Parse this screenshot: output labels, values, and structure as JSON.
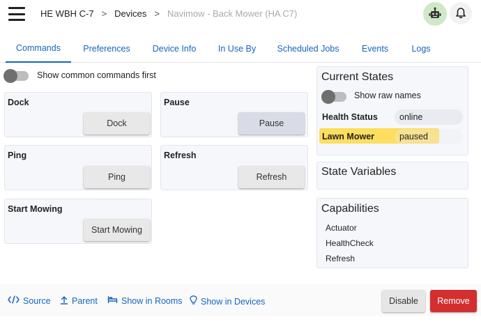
{
  "header": {
    "breadcrumbs": [
      "HE WBH C-7",
      "Devices",
      "Navimow - Back Mower (HA C7)"
    ],
    "separator": ">",
    "icons": [
      "menu-icon",
      "robot-icon",
      "bell-icon"
    ]
  },
  "tabs": [
    {
      "label": "Commands",
      "active": true
    },
    {
      "label": "Preferences",
      "active": false
    },
    {
      "label": "Device Info",
      "active": false
    },
    {
      "label": "In Use By",
      "active": false
    },
    {
      "label": "Scheduled Jobs",
      "active": false
    },
    {
      "label": "Events",
      "active": false
    },
    {
      "label": "Logs",
      "active": false
    }
  ],
  "commands": {
    "toggle_label": "Show common commands first",
    "cards": [
      {
        "title": "Dock",
        "button": "Dock"
      },
      {
        "title": "Pause",
        "button": "Pause"
      },
      {
        "title": "Ping",
        "button": "Ping"
      },
      {
        "title": "Refresh",
        "button": "Refresh"
      },
      {
        "title": "Start Mowing",
        "button": "Start Mowing"
      }
    ]
  },
  "current_states": {
    "title": "Current States",
    "toggle_label": "Show raw names",
    "rows": [
      {
        "name": "Health Status",
        "value": "online"
      },
      {
        "name": "Lawn Mower",
        "value": "paused",
        "highlighted": true
      }
    ]
  },
  "state_variables": {
    "title": "State Variables"
  },
  "capabilities": {
    "title": "Capabilities",
    "items": [
      "Actuator",
      "HealthCheck",
      "Refresh"
    ]
  },
  "footer": {
    "links": [
      {
        "label": "Source",
        "icon": "code-icon"
      },
      {
        "label": "Parent",
        "icon": "upload-icon"
      },
      {
        "label": "Show in Rooms",
        "icon": "bed-icon"
      },
      {
        "label": "Show in Devices",
        "icon": "lightbulb-icon"
      }
    ],
    "disable_label": "Disable",
    "remove_label": "Remove"
  },
  "colors": {
    "link": "#1565c0",
    "remove": "#d32f2f",
    "highlight": "#ffd528",
    "hub_icon_bg": "#cfe9c7"
  }
}
